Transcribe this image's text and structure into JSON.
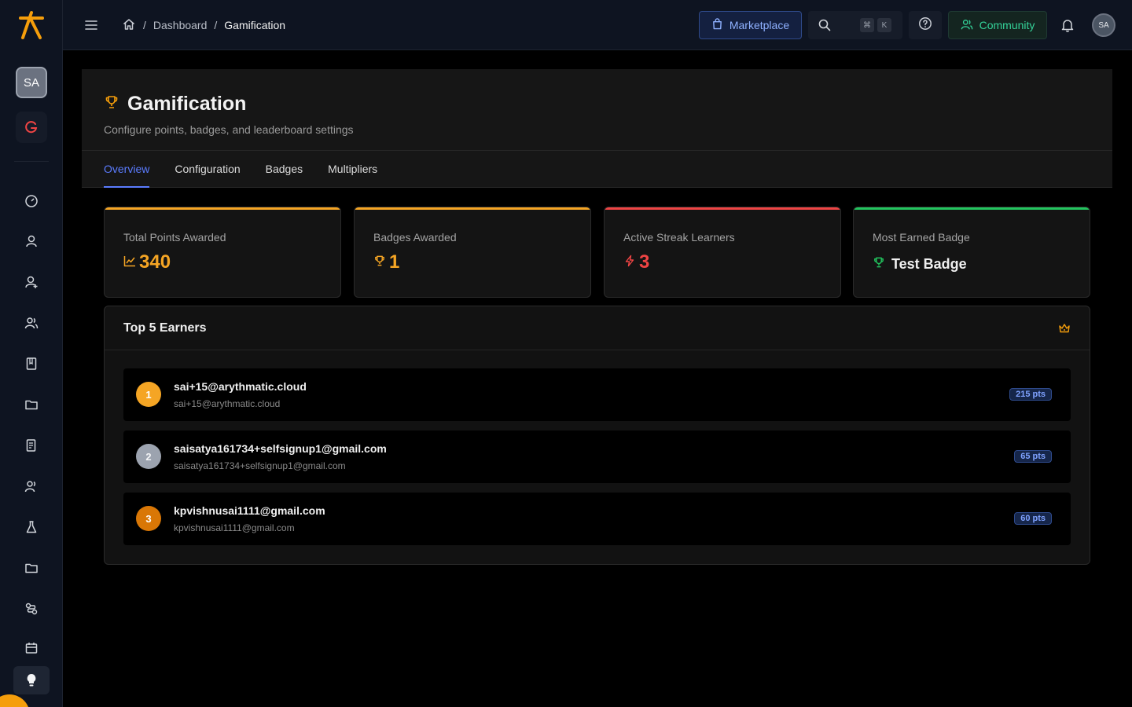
{
  "sidebar": {
    "avatar_initials": "SA",
    "icons": [
      "dashboard-icon",
      "user-icon",
      "user-add-icon",
      "users-icon",
      "book-icon",
      "folder-icon",
      "report-icon",
      "group-icon",
      "flask-icon",
      "folder-icon",
      "workflow-icon",
      "calendar-icon"
    ],
    "accent": "#f59e0b"
  },
  "topbar": {
    "breadcrumb": {
      "dashboard": "Dashboard",
      "separator": "/",
      "current": "Gamification"
    },
    "marketplace_label": "Marketplace",
    "shortcut_cmd": "⌘",
    "shortcut_key": "K",
    "community_label": "Community",
    "avatar_initials": "SA"
  },
  "page": {
    "title": "Gamification",
    "subtitle": "Configure points, badges, and leaderboard settings",
    "tabs": [
      {
        "label": "Overview",
        "active": true
      },
      {
        "label": "Configuration",
        "active": false
      },
      {
        "label": "Badges",
        "active": false
      },
      {
        "label": "Multipliers",
        "active": false
      }
    ]
  },
  "stats": [
    {
      "label": "Total Points Awarded",
      "value": "340",
      "icon": "trend-icon",
      "color": "#f5a524"
    },
    {
      "label": "Badges Awarded",
      "value": "1",
      "icon": "trophy-icon",
      "color": "#f5a524"
    },
    {
      "label": "Active Streak Learners",
      "value": "3",
      "icon": "bolt-icon",
      "color": "#ef4444"
    },
    {
      "label": "Most Earned Badge",
      "value": "Test Badge",
      "icon": "trophy-icon",
      "color": "#22c55e"
    }
  ],
  "earners": {
    "title": "Top 5 Earners",
    "rows": [
      {
        "rank": "1",
        "name": "sai+15@arythmatic.cloud",
        "email": "sai+15@arythmatic.cloud",
        "points": "215 pts",
        "color": "#f5a524"
      },
      {
        "rank": "2",
        "name": "saisatya161734+selfsignup1@gmail.com",
        "email": "saisatya161734+selfsignup1@gmail.com",
        "points": "65 pts",
        "color": "#9ca3af"
      },
      {
        "rank": "3",
        "name": "kpvishnusai1111@gmail.com",
        "email": "kpvishnusai1111@gmail.com",
        "points": "60 pts",
        "color": "#d97706"
      }
    ]
  }
}
